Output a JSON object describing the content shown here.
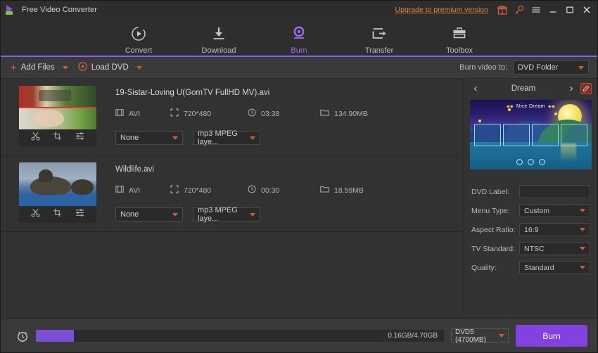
{
  "window": {
    "title": "Free Video Converter",
    "upgrade_link": "Upgrade to premium version",
    "icons": {
      "gift": "gift-icon",
      "key": "key-icon",
      "menu": "hamburger-menu-icon",
      "minimize": "minimize-icon",
      "maximize": "maximize-icon",
      "close": "close-icon"
    }
  },
  "nav": {
    "accent_color": "#8a5cf0",
    "items": [
      {
        "label": "Convert",
        "icon": "convert-icon",
        "active": false
      },
      {
        "label": "Download",
        "icon": "download-icon",
        "active": false
      },
      {
        "label": "Burn",
        "icon": "burn-icon",
        "active": true
      },
      {
        "label": "Transfer",
        "icon": "transfer-icon",
        "active": false
      },
      {
        "label": "Toolbox",
        "icon": "toolbox-icon",
        "active": false
      }
    ]
  },
  "toolbar": {
    "add_files_label": "Add Files",
    "load_dvd_label": "Load DVD",
    "burn_video_to_label": "Burn video to:",
    "burn_target_value": "DVD Folder"
  },
  "files": [
    {
      "name": "19-Sistar-Loving U(GomTV FullHD MV).avi",
      "format": "AVI",
      "resolution": "720*480",
      "duration": "03:38",
      "size": "134.90MB",
      "subtitle_value": "None",
      "audio_value": "mp3 MPEG laye..."
    },
    {
      "name": "Wildlife.avi",
      "format": "AVI",
      "resolution": "720*480",
      "duration": "00:30",
      "size": "18.59MB",
      "subtitle_value": "None",
      "audio_value": "mp3 MPEG laye..."
    }
  ],
  "panel": {
    "template_name": "Dream",
    "preview_title": "Nice Dream",
    "settings": [
      {
        "label": "DVD Label:",
        "value": "",
        "type": "input"
      },
      {
        "label": "Menu Type:",
        "value": "Custom",
        "type": "select"
      },
      {
        "label": "Aspect Ratio:",
        "value": "16:9",
        "type": "select"
      },
      {
        "label": "TV Standard:",
        "value": "NTSC",
        "type": "select"
      },
      {
        "label": "Quality:",
        "value": "Standard",
        "type": "select"
      }
    ]
  },
  "bottom": {
    "size_text": "0.16GB/4.70GB",
    "disc_type": "DVD5 (4700MB)",
    "burn_label": "Burn",
    "progress_percent": 9,
    "progress_color": "#7b4fd6",
    "burn_button_color": "#8241e0"
  }
}
